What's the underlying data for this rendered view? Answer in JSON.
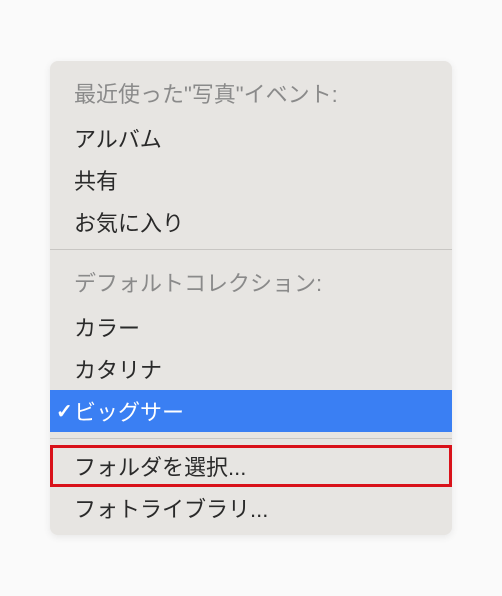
{
  "menu": {
    "sections": [
      {
        "header": "最近使った\"写真\"イベント:",
        "items": [
          {
            "label": "アルバム",
            "selected": false,
            "highlighted": false
          },
          {
            "label": "共有",
            "selected": false,
            "highlighted": false
          },
          {
            "label": "お気に入り",
            "selected": false,
            "highlighted": false
          }
        ]
      },
      {
        "header": "デフォルトコレクション:",
        "items": [
          {
            "label": "カラー",
            "selected": false,
            "highlighted": false
          },
          {
            "label": "カタリナ",
            "selected": false,
            "highlighted": false
          },
          {
            "label": "ビッグサー",
            "selected": true,
            "highlighted": false
          }
        ]
      },
      {
        "header": null,
        "items": [
          {
            "label": "フォルダを選択...",
            "selected": false,
            "highlighted": true
          },
          {
            "label": "フォトライブラリ...",
            "selected": false,
            "highlighted": false
          }
        ]
      }
    ],
    "checkmark": "✓"
  }
}
